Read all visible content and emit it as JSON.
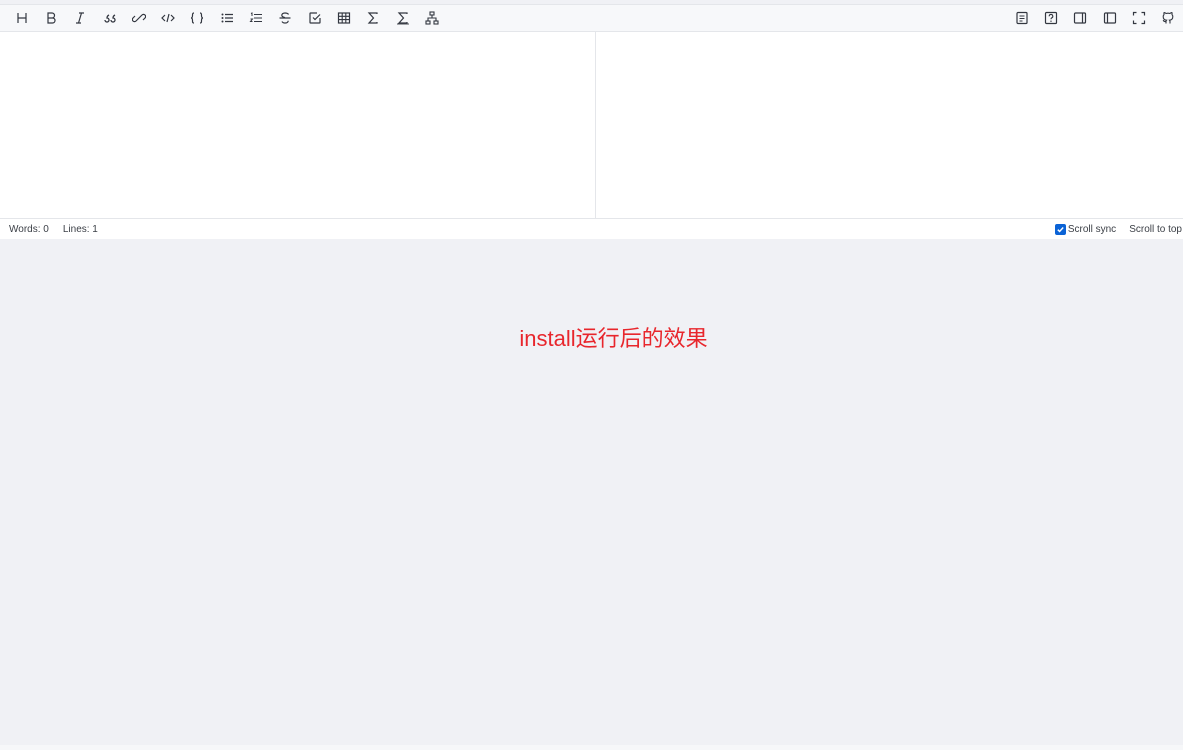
{
  "toolbar": {
    "left_tools": [
      {
        "name": "heading",
        "glyph": "H"
      },
      {
        "name": "bold",
        "glyph": "B"
      },
      {
        "name": "italic",
        "glyph": "I"
      },
      {
        "name": "quote",
        "glyph": "❝"
      },
      {
        "name": "link",
        "glyph": "link"
      },
      {
        "name": "code",
        "glyph": "</>"
      },
      {
        "name": "code-block",
        "glyph": "{}"
      },
      {
        "name": "unordered-list",
        "glyph": "ul"
      },
      {
        "name": "ordered-list",
        "glyph": "ol"
      },
      {
        "name": "strikethrough",
        "glyph": "S"
      },
      {
        "name": "task-list",
        "glyph": "task"
      },
      {
        "name": "table",
        "glyph": "table"
      },
      {
        "name": "inline-math",
        "glyph": "Σ"
      },
      {
        "name": "block-math",
        "glyph": "Σ"
      },
      {
        "name": "mermaid",
        "glyph": "diagram"
      }
    ],
    "right_tools": [
      {
        "name": "table-of-contents"
      },
      {
        "name": "help"
      },
      {
        "name": "toggle-preview"
      },
      {
        "name": "toggle-editor"
      },
      {
        "name": "fullscreen"
      },
      {
        "name": "github"
      }
    ]
  },
  "status": {
    "words": "Words: 0",
    "lines": "Lines: 1",
    "scroll_sync": "Scroll sync",
    "scroll_sync_checked": true,
    "scroll_to_top": "Scroll to top"
  },
  "caption": "install运行后的效果",
  "colors": {
    "caption": "#e8262c",
    "checkbox": "#0b63d6",
    "background": "#f0f1f5"
  }
}
